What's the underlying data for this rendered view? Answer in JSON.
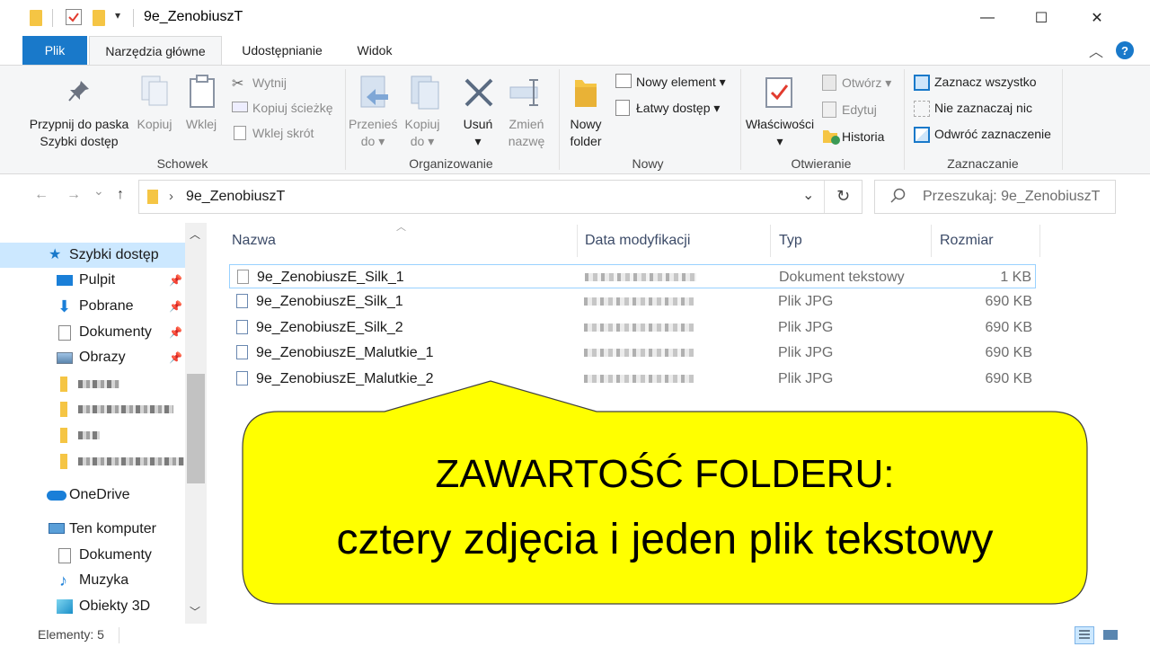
{
  "window": {
    "title": "9e_ZenobiuszT",
    "minimize_glyph": "—",
    "maximize_glyph": "☐",
    "close_glyph": "✕"
  },
  "tabs": {
    "file": "Plik",
    "home": "Narzędzia główne",
    "share": "Udostępnianie",
    "view": "Widok",
    "help_glyph": "?"
  },
  "ribbon": {
    "clipboard": {
      "group": "Schowek",
      "pin_line1": "Przypnij do paska",
      "pin_line2": "Szybki dostęp",
      "copy": "Kopiuj",
      "paste": "Wklej",
      "cut": "Wytnij",
      "copy_path": "Kopiuj ścieżkę",
      "paste_shortcut": "Wklej skrót"
    },
    "organize": {
      "group": "Organizowanie",
      "move_line1": "Przenieś",
      "move_line2": "do ▾",
      "copyto_line1": "Kopiuj",
      "copyto_line2": "do ▾",
      "delete_line1": "Usuń",
      "delete_line2": "▾",
      "rename_line1": "Zmień",
      "rename_line2": "nazwę"
    },
    "new": {
      "group": "Nowy",
      "newfolder_line1": "Nowy",
      "newfolder_line2": "folder",
      "new_item": "Nowy element ▾",
      "easy_access": "Łatwy dostęp ▾"
    },
    "open": {
      "group": "Otwieranie",
      "properties_line1": "Właściwości",
      "properties_line2": "▾",
      "open": "Otwórz ▾",
      "edit": "Edytuj",
      "history": "Historia"
    },
    "select": {
      "group": "Zaznaczanie",
      "select_all": "Zaznacz wszystko",
      "select_none": "Nie zaznaczaj nic",
      "invert": "Odwróć zaznaczenie"
    }
  },
  "address": {
    "back": "←",
    "forward": "→",
    "recent": "⌄",
    "up": "↑",
    "crumb_sep": "›",
    "path": "9e_ZenobiuszT",
    "dropdown": "⌄",
    "refresh": "↻",
    "search_placeholder": "Przeszukaj: 9e_ZenobiuszT"
  },
  "navpane": {
    "quick_access": "Szybki dostęp",
    "items": [
      "Pulpit",
      "Pobrane",
      "Dokumenty",
      "Obrazy"
    ],
    "onedrive": "OneDrive",
    "this_pc": "Ten komputer",
    "pc_items": [
      "Dokumenty",
      "Muzyka",
      "Obiekty 3D"
    ]
  },
  "filelist": {
    "columns": {
      "name": "Nazwa",
      "date": "Data modyfikacji",
      "type": "Typ",
      "size": "Rozmiar"
    },
    "files": [
      {
        "name": "9e_ZenobiuszE_Silk_1",
        "type": "Dokument tekstowy",
        "size": "1 KB"
      },
      {
        "name": "9e_ZenobiuszE_Silk_1",
        "type": "Plik JPG",
        "size": "690 KB"
      },
      {
        "name": "9e_ZenobiuszE_Silk_2",
        "type": "Plik JPG",
        "size": "690 KB"
      },
      {
        "name": "9e_ZenobiuszE_Malutkie_1",
        "type": "Plik JPG",
        "size": "690 KB"
      },
      {
        "name": "9e_ZenobiuszE_Malutkie_2",
        "type": "Plik JPG",
        "size": "690 KB"
      }
    ]
  },
  "callout": {
    "line1": "ZAWARTOŚĆ FOLDERU:",
    "line2": "cztery zdjęcia i jeden plik tekstowy",
    "fill": "#ffff00"
  },
  "status": {
    "count": "Elementy: 5"
  }
}
